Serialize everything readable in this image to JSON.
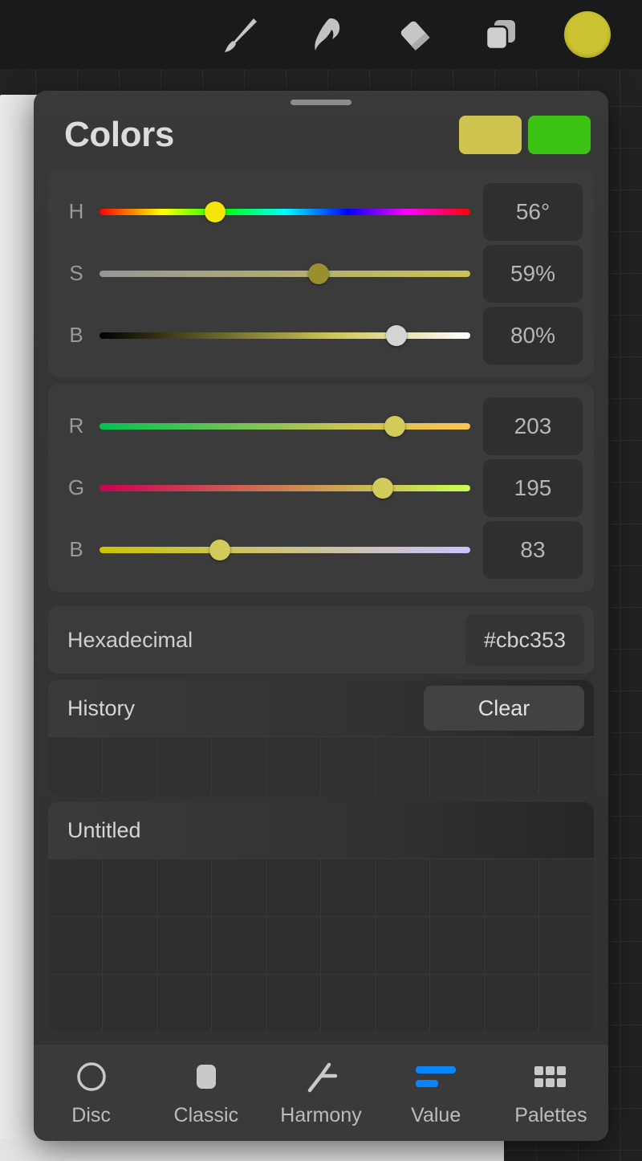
{
  "toolbar": {
    "tools": [
      {
        "name": "brush-tool",
        "label": "Brush"
      },
      {
        "name": "smudge-tool",
        "label": "Smudge"
      },
      {
        "name": "eraser-tool",
        "label": "Eraser"
      },
      {
        "name": "layers-tool",
        "label": "Layers"
      }
    ],
    "active_color_hex": "#cbc331"
  },
  "panel": {
    "title": "Colors",
    "primary_swatch": "#cfc44f",
    "secondary_swatch": "#3cc213"
  },
  "hsb": {
    "rows": [
      {
        "label": "H",
        "value": "56°",
        "pos_pct": 31.2
      },
      {
        "label": "S",
        "value": "59%",
        "pos_pct": 59.0
      },
      {
        "label": "B",
        "value": "80%",
        "pos_pct": 80.0
      }
    ]
  },
  "rgb": {
    "rows": [
      {
        "label": "R",
        "value": "203",
        "pos_pct": 79.6
      },
      {
        "label": "G",
        "value": "195",
        "pos_pct": 76.5
      },
      {
        "label": "B",
        "value": "83",
        "pos_pct": 32.5
      }
    ]
  },
  "hexadecimal": {
    "label": "Hexadecimal",
    "value": "#cbc353"
  },
  "history": {
    "title": "History",
    "clear_label": "Clear",
    "columns": 10,
    "rows": 1,
    "swatches": []
  },
  "palette": {
    "title": "Untitled",
    "columns": 10,
    "rows": 3,
    "swatches": []
  },
  "tabs": [
    {
      "label": "Disc",
      "icon": "circle-outline-icon",
      "active": false
    },
    {
      "label": "Classic",
      "icon": "rounded-square-icon",
      "active": false
    },
    {
      "label": "Harmony",
      "icon": "harmony-branch-icon",
      "active": false
    },
    {
      "label": "Value",
      "icon": "value-bars-icon",
      "active": true
    },
    {
      "label": "Palettes",
      "icon": "grid-dots-icon",
      "active": false
    }
  ],
  "colors": {
    "accent": "#0a84ff",
    "panel_bg": "#343434",
    "group_bg": "#3b3b3b"
  }
}
